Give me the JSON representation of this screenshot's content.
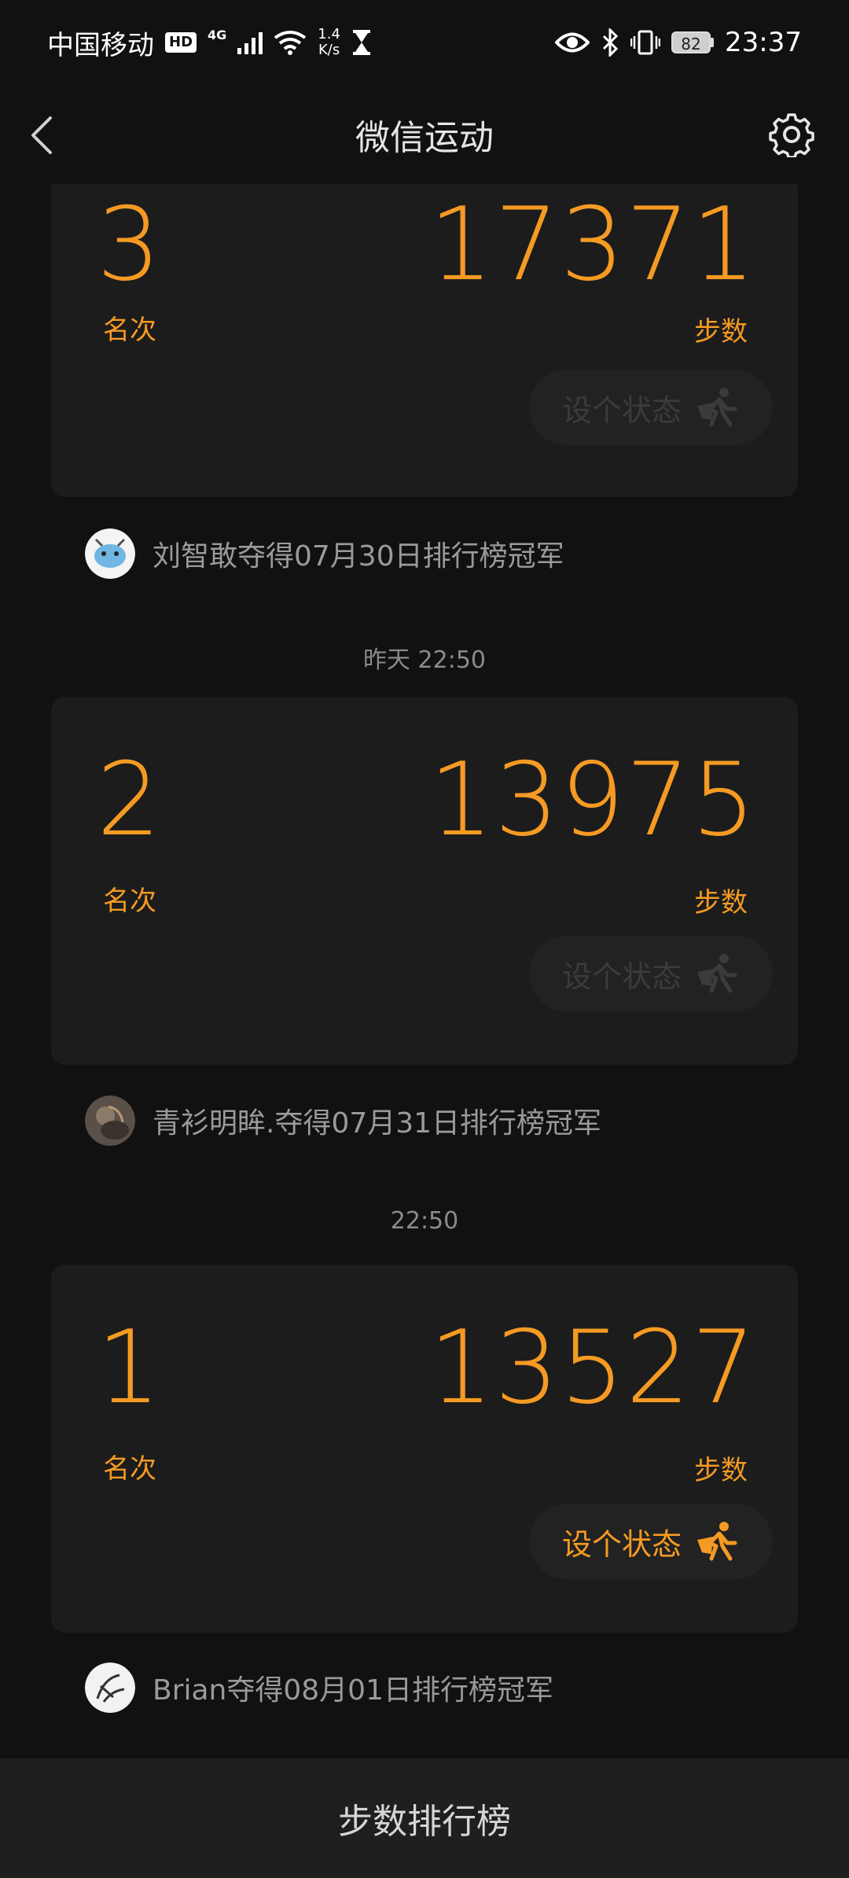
{
  "status_bar": {
    "carrier": "中国移动",
    "hd": "HD",
    "network": "4G",
    "speed_value": "1.4",
    "speed_unit": "K/s",
    "battery": "82",
    "time": "23:37"
  },
  "nav": {
    "title": "微信运动"
  },
  "cards": [
    {
      "rank": "3",
      "rank_label": "名次",
      "steps": "17371",
      "steps_label": "步数",
      "status_button": "设个状态"
    },
    {
      "rank": "2",
      "rank_label": "名次",
      "steps": "13975",
      "steps_label": "步数",
      "status_button": "设个状态"
    },
    {
      "rank": "1",
      "rank_label": "名次",
      "steps": "13527",
      "steps_label": "步数",
      "status_button": "设个状态"
    }
  ],
  "champions": [
    {
      "text": "刘智敢夺得07月30日排行榜冠军"
    },
    {
      "text": "青衫明眸.夺得07月31日排行榜冠军"
    },
    {
      "text": "Brian夺得08月01日排行榜冠军"
    }
  ],
  "timestamps": [
    "昨天 22:50",
    "22:50"
  ],
  "bottom_bar": {
    "label": "步数排行榜"
  },
  "colors": {
    "accent": "#f59a23",
    "background": "#111111",
    "card": "#1c1c1c"
  }
}
